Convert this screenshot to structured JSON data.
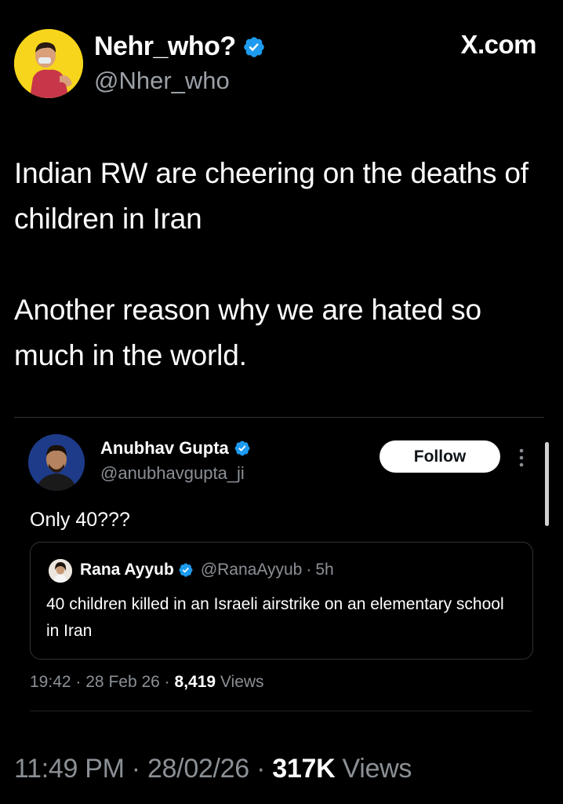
{
  "tweet": {
    "author": {
      "display_name": "Nehr_who?",
      "handle": "@Nher_who",
      "verified": true
    },
    "source": "X.com",
    "text": [
      "Indian RW are cheering on the deaths of children in Iran",
      "Another reason why we are hated so much in the world."
    ],
    "time": "11:49 PM",
    "date": "28/02/26",
    "views_count": "317K",
    "views_label": "Views"
  },
  "embed": {
    "author": {
      "display_name": "Anubhav Gupta",
      "handle": "@anubhavgupta_ji",
      "verified": true
    },
    "follow_label": "Follow",
    "text": "Only 40???",
    "quote": {
      "display_name": "Rana Ayyub",
      "handle": "@RanaAyyub",
      "age": "5h",
      "text": "40 children killed in an Israeli airstrike on an elementary school in Iran"
    },
    "time": "19:42",
    "date": "28 Feb 26",
    "views_count": "8,419",
    "views_label": "Views"
  },
  "colors": {
    "background": "#000000",
    "verified_blue": "#1d9bf0",
    "secondary_text": "#8b9096",
    "avatar_bg": "#f7d51c"
  }
}
